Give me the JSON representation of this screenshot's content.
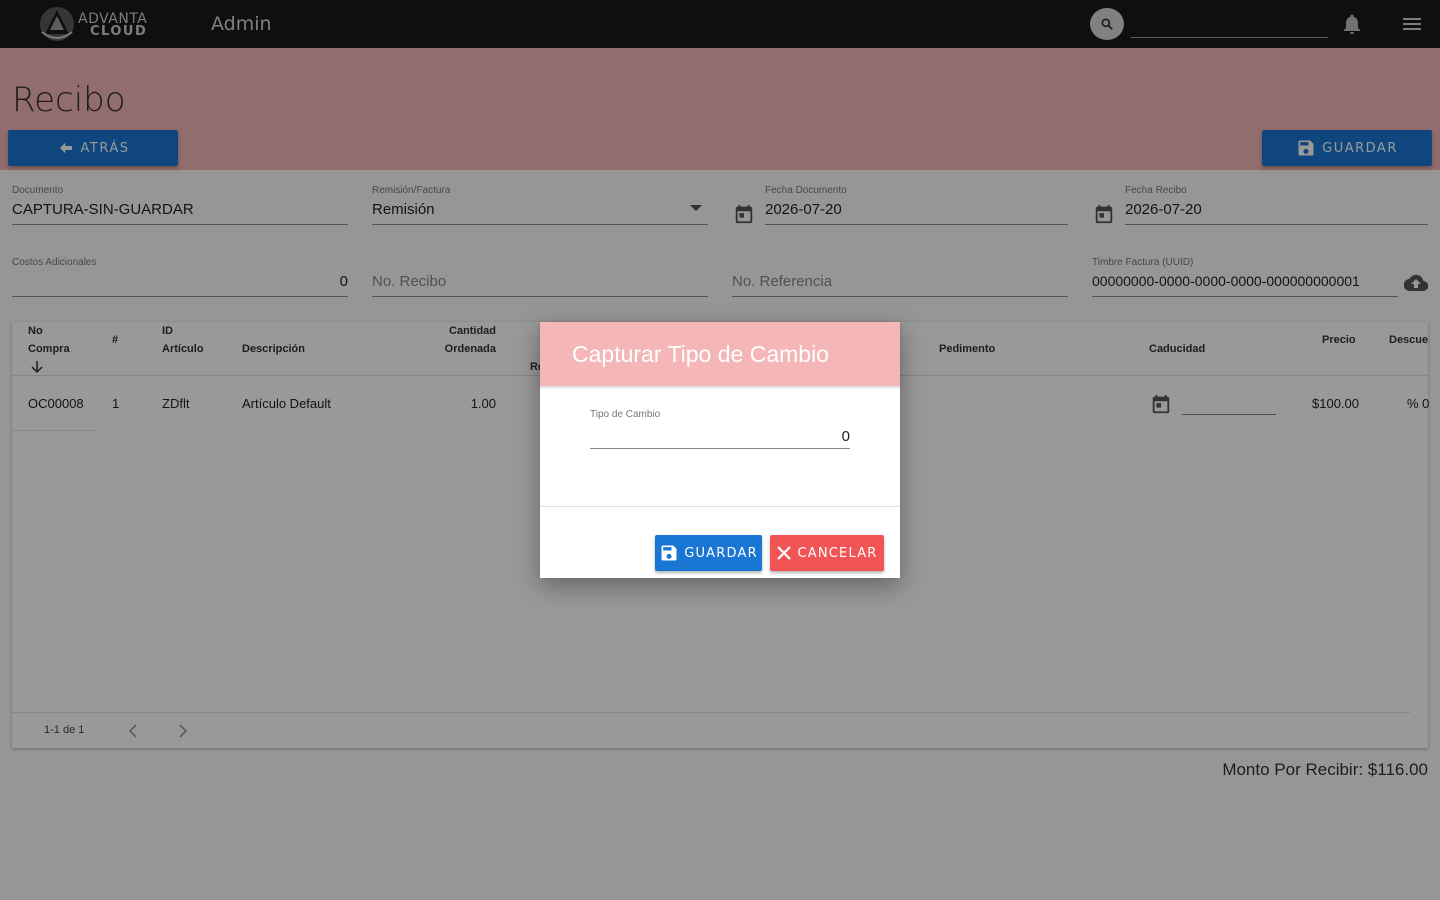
{
  "topbar": {
    "brand_line1": "ADVANTA",
    "brand_line2": "CLOUD",
    "app_title": "Admin",
    "search_placeholder": ""
  },
  "page": {
    "title": "Recibo",
    "back_label": "ATRÁS",
    "save_label": "GUARDAR"
  },
  "form": {
    "documento": {
      "label": "Documento",
      "value": "CAPTURA-SIN-GUARDAR"
    },
    "remision": {
      "label": "Remisión/Factura",
      "value": "Remisión"
    },
    "fecha_documento": {
      "label": "Fecha Documento",
      "value": "2026-07-20"
    },
    "fecha_recibo": {
      "label": "Fecha Recibo",
      "value": "2026-07-20"
    },
    "costos": {
      "label": "Costos Adicionales",
      "value": "0"
    },
    "no_recibo": {
      "placeholder": "No. Recibo"
    },
    "no_referencia": {
      "placeholder": "No. Referencia"
    },
    "timbre": {
      "label": "Timbre Factura (UUID)",
      "value": "00000000-0000-0000-0000-000000000001"
    }
  },
  "table": {
    "headers": {
      "no_compra_1": "No",
      "no_compra_2": "Compra",
      "num": "#",
      "id_1": "ID",
      "id_2": "Artículo",
      "descripcion": "Descripción",
      "cantidad_1": "Cantidad",
      "cantidad_2": "Ordenada",
      "recibida_partial": "Re",
      "pedimento": "Pedimento",
      "caducidad": "Caducidad",
      "precio": "Precio",
      "descuento": "Descue"
    },
    "rows": [
      {
        "no_compra": "OC00008",
        "num": "1",
        "id": "ZDflt",
        "descripcion": "Artículo Default",
        "cantidad": "1.00",
        "precio": "$100.00",
        "descuento": "% 0"
      }
    ],
    "pager": "1-1 de 1"
  },
  "total": "Monto Por Recibir: $116.00",
  "dialog": {
    "title": "Capturar Tipo de Cambio",
    "field_label": "Tipo de Cambio",
    "field_value": "0",
    "save_label": "GUARDAR",
    "cancel_label": "CANCELAR"
  },
  "colors": {
    "header_band": "#f4b6b6",
    "primary": "#1976d2",
    "danger": "#f05454",
    "topbar": "#1a1a1a"
  }
}
